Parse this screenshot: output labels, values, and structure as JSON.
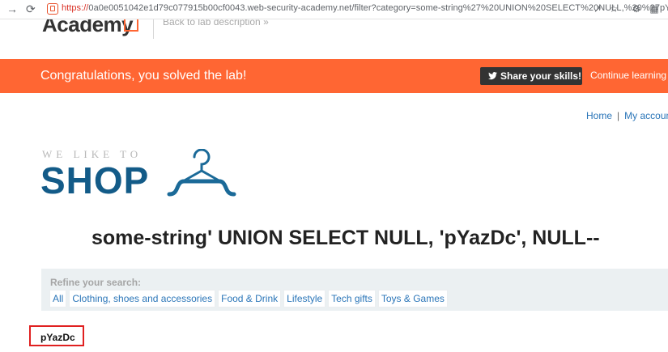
{
  "browser": {
    "url_protocol": "https://",
    "url_rest": "0a0e0051042e1d79c077915b00cf0043.web-security-academy.net/filter?category=some-string%27%20UNION%20SELECT%20NULL,%20%27pYaz..."
  },
  "academy": {
    "logo_text": "Academy",
    "back_link": "Back to lab description"
  },
  "banner": {
    "message": "Congratulations, you solved the lab!",
    "share_label": "Share your skills!",
    "continue_label": "Continue learning",
    "color": "#ff6633"
  },
  "toplinks": {
    "home": "Home",
    "separator": "|",
    "account": "My account"
  },
  "shop_logo": {
    "tagline": "WE LIKE TO",
    "name": "SHOP"
  },
  "heading": "some-string' UNION SELECT NULL, 'pYazDc', NULL--",
  "filter": {
    "label": "Refine your search:",
    "categories": [
      "All",
      "Clothing, shoes and accessories",
      "Food & Drink",
      "Lifestyle",
      "Tech gifts",
      "Toys & Games"
    ]
  },
  "result": {
    "value": "pYazDc"
  }
}
